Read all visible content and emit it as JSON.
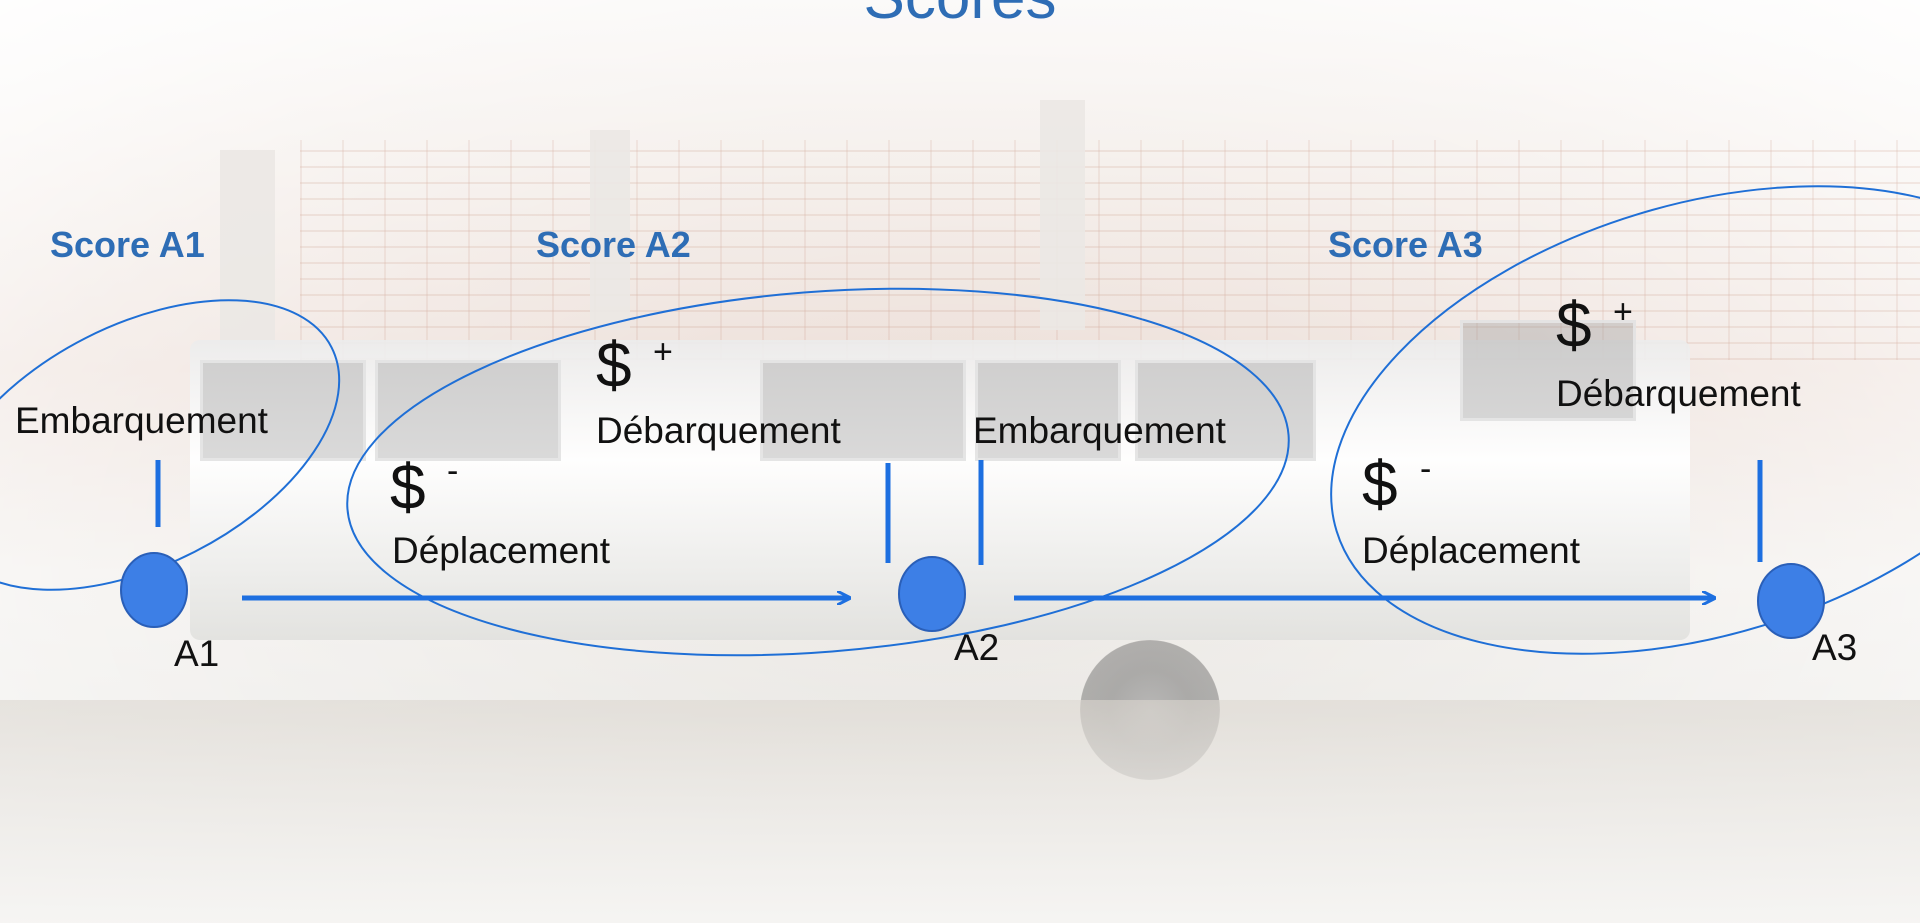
{
  "title": "Scores",
  "scores": [
    {
      "label": "Score A1"
    },
    {
      "label": "Score A2"
    },
    {
      "label": "Score A3"
    }
  ],
  "stops": [
    {
      "label": "A1"
    },
    {
      "label": "A2"
    },
    {
      "label": "A3"
    }
  ],
  "labels": {
    "embarquement_1": "Embarquement",
    "deplacement_1": "Déplacement",
    "debarquement_1": "Débarquement",
    "embarquement_2": "Embarquement",
    "deplacement_2": "Déplacement",
    "debarquement_2": "Débarquement"
  },
  "symbols": {
    "dollar": "$",
    "minus": "-",
    "plus": "+"
  },
  "colors": {
    "title": "#2e6db5",
    "score_label": "#2e6db5",
    "ellipse": "#1f6fd6",
    "arrow": "#1d6fe0",
    "node_fill": "#3d7fe6",
    "node_stroke": "#2a5fb8"
  }
}
